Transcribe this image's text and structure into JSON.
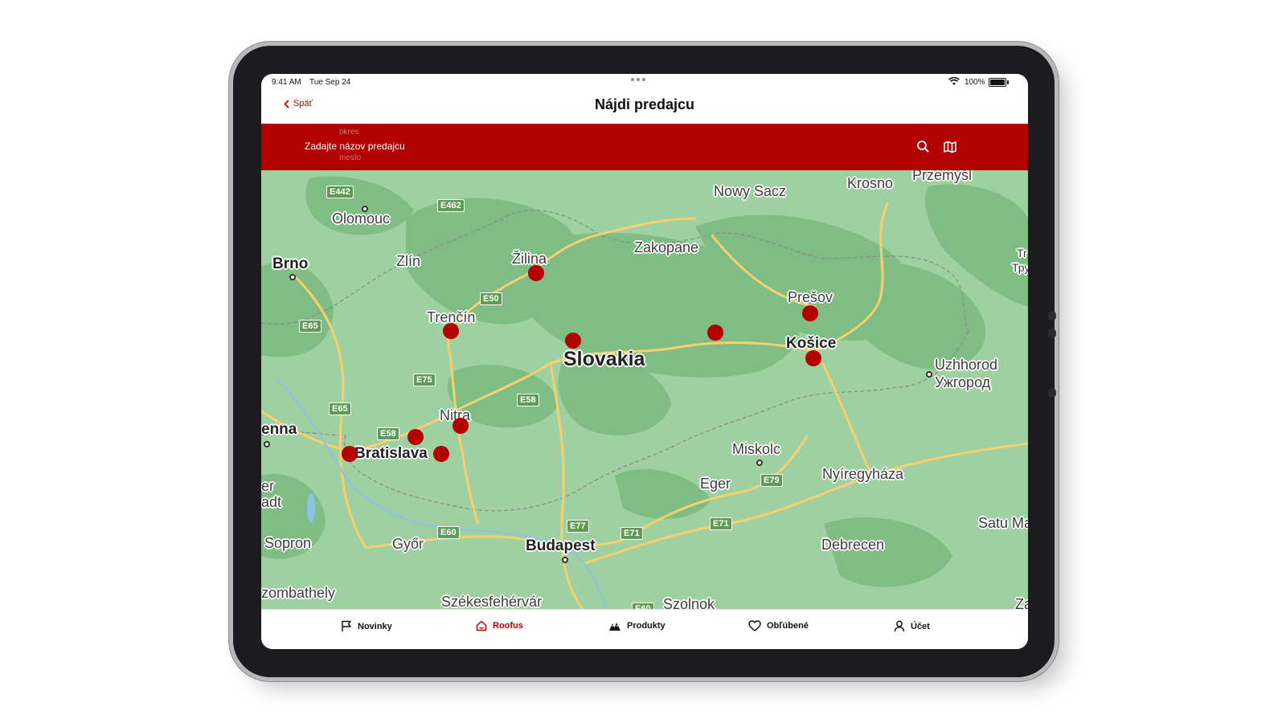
{
  "status_bar": {
    "time": "9:41 AM",
    "date": "Tue Sep 24",
    "battery": "100%"
  },
  "header": {
    "back_label": "Späť",
    "title": "Nájdi predajcu"
  },
  "search": {
    "picker_above": "okres",
    "placeholder": "Zadajte názov predajcu",
    "picker_below": "mesto",
    "icons": [
      "search-icon",
      "map-icon"
    ]
  },
  "map": {
    "country": "Slovakia",
    "places": [
      "Olomouc",
      "Brno",
      "Zlín",
      "Žilina",
      "Trenčín",
      "Nitra",
      "Bratislava",
      "Nowy Sacz",
      "Krosno",
      "Przemyśl",
      "Zakopane",
      "Prešov",
      "Košice",
      "Uzhhorod",
      "Ужгород",
      "Miskolc",
      "Nyíregyháza",
      "Eger",
      "Budapest",
      "Győr",
      "Sopron",
      "Debrecen",
      "Satu Ma",
      "Székesfehérvár",
      "Szolnok",
      "zombathely",
      "enna",
      "Tr",
      "Тру",
      "Za",
      "er",
      "adt"
    ],
    "road_labels": [
      "E442",
      "E462",
      "E50",
      "E65",
      "E75",
      "E65",
      "E58",
      "E58",
      "E60",
      "E77",
      "E71",
      "E71",
      "E79",
      "E60"
    ],
    "dealer_marker_color": "#b30000",
    "dealer_locations": [
      "Žilina",
      "Trenčín",
      "Central Slovakia",
      "Spiš region",
      "Prešov",
      "Košice",
      "Nitra",
      "Trnava region",
      "Senec region",
      "Bratislava"
    ]
  },
  "tabs": [
    {
      "label": "Novinky",
      "icon": "flag-icon",
      "active": false
    },
    {
      "label": "Roofus",
      "icon": "house-icon",
      "active": true
    },
    {
      "label": "Produkty",
      "icon": "roof-icon",
      "active": false
    },
    {
      "label": "Obľúbené",
      "icon": "heart-icon",
      "active": false
    },
    {
      "label": "Účet",
      "icon": "user-icon",
      "active": false
    }
  ],
  "colors": {
    "accent": "#b30000",
    "map_land": "#9fd0a1",
    "map_forest": "#7fbd84",
    "roads": "#f6cf6e"
  }
}
